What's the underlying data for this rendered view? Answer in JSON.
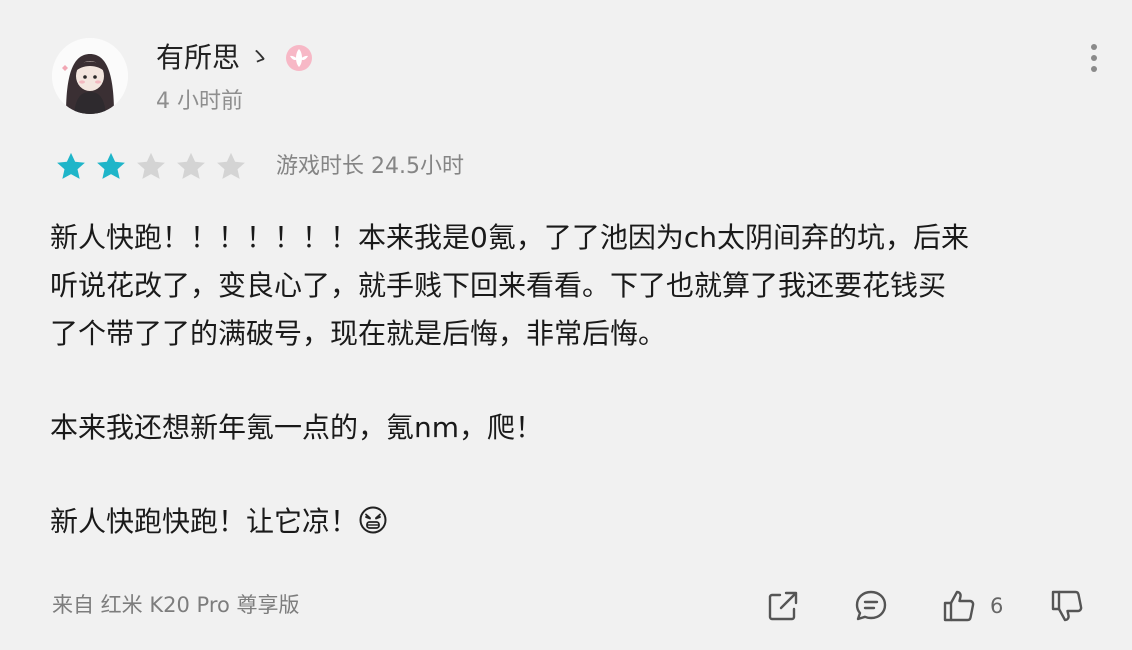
{
  "user": {
    "name": "有所思",
    "name_suffix": "ゝ",
    "posted_time": "4 小时前"
  },
  "rating": {
    "stars_filled": 2,
    "stars_total": 5,
    "playtime": "游戏时长 24.5小时",
    "star_color": "#1fb5c9",
    "star_empty_color": "#d4d4d4"
  },
  "content": {
    "paragraph1_line1": "新人快跑！！！！！！！本来我是0氪，了了池因为ch太阴间弃的坑，后来",
    "paragraph1_line2": "听说花改了，变良心了，就手贱下回来看看。下了也就算了我还要花钱买",
    "paragraph1_line3": "了个带了了的满破号，现在就是后悔，非常后悔。",
    "paragraph2": "本来我还想新年氪一点的，氪nm，爬！",
    "paragraph3": "新人快跑快跑！让它凉！",
    "paragraph3_emoji": "weary-face-emoji"
  },
  "footer": {
    "device": "来自 红米 K20 Pro 尊享版",
    "like_count": "6"
  },
  "icons": {
    "more": "more-vertical-icon",
    "share": "share-icon",
    "comment": "comment-icon",
    "like": "thumbs-up-icon",
    "dislike": "thumbs-down-icon",
    "badge": "pink-badge-icon"
  }
}
